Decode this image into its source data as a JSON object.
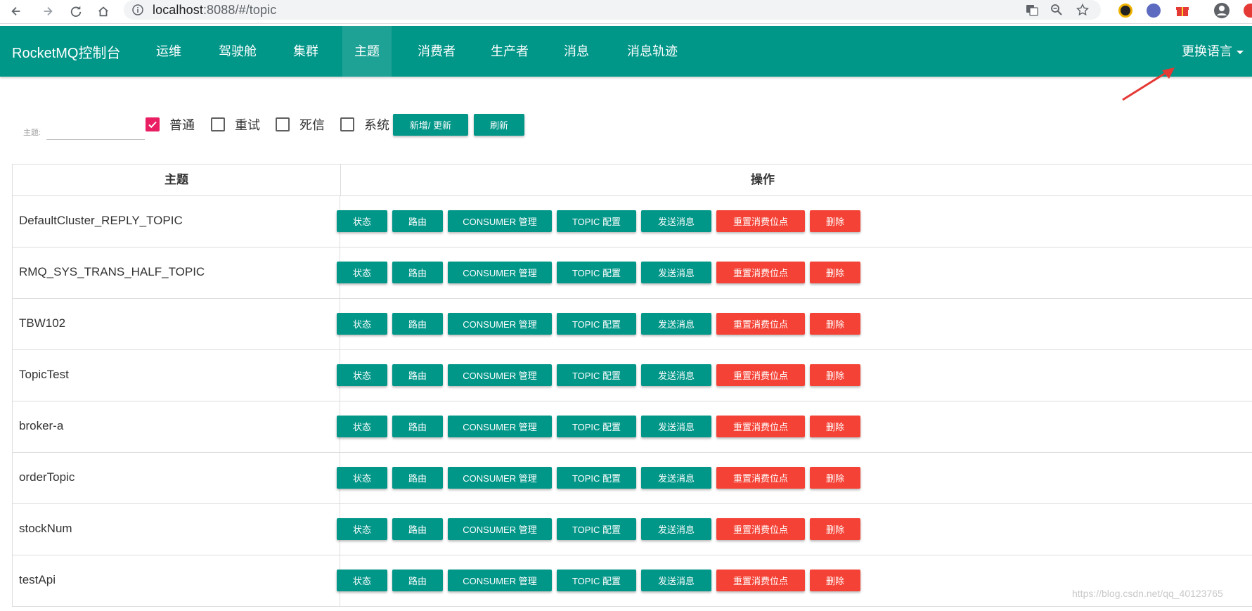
{
  "browser": {
    "url_host": "localhost",
    "url_rest": ":8088/#/topic"
  },
  "navbar": {
    "brand": "RocketMQ控制台",
    "items": [
      {
        "label": "运维"
      },
      {
        "label": "驾驶舱"
      },
      {
        "label": "集群"
      },
      {
        "label": "主题"
      },
      {
        "label": "消费者"
      },
      {
        "label": "生产者"
      },
      {
        "label": "消息"
      },
      {
        "label": "消息轨迹"
      }
    ],
    "active": "主题",
    "language_label": "更换语言"
  },
  "filter": {
    "topic_label": "主题:",
    "topic_value": "",
    "checkboxes": [
      {
        "label": "普通",
        "checked": true
      },
      {
        "label": "重试",
        "checked": false
      },
      {
        "label": "死信",
        "checked": false
      },
      {
        "label": "系统",
        "checked": false
      }
    ],
    "add_update_label": "新增/ 更新",
    "refresh_label": "刷新"
  },
  "table": {
    "headers": [
      "主题",
      "操作"
    ],
    "actions": [
      "状态",
      "路由",
      "CONSUMER 管理",
      "TOPIC 配置",
      "发送消息",
      "重置消费位点",
      "删除"
    ],
    "rows": [
      {
        "topic": "DefaultCluster_REPLY_TOPIC"
      },
      {
        "topic": "RMQ_SYS_TRANS_HALF_TOPIC"
      },
      {
        "topic": "TBW102"
      },
      {
        "topic": "TopicTest"
      },
      {
        "topic": "broker-a"
      },
      {
        "topic": "orderTopic"
      },
      {
        "topic": "stockNum"
      },
      {
        "topic": "testApi"
      }
    ]
  },
  "colors": {
    "primary": "#009688",
    "danger": "#f44336",
    "checkbox_checked": "#e91e63"
  },
  "watermark": "https://blog.csdn.net/qq_40123765"
}
